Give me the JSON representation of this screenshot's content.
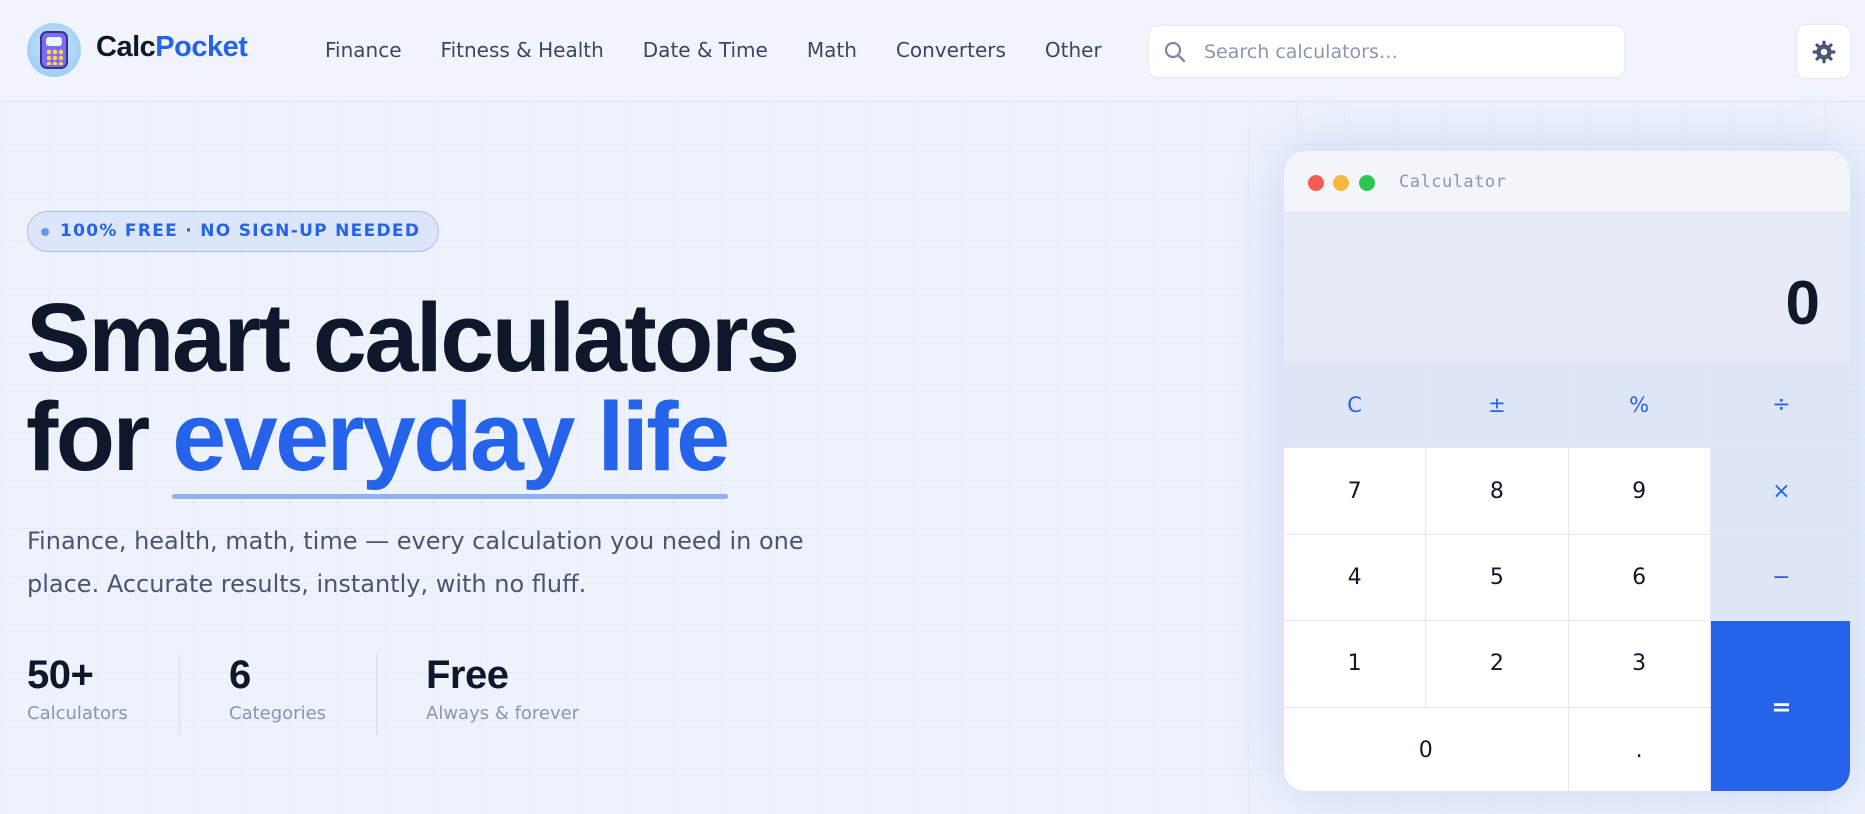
{
  "header": {
    "brand_part1": "Calc",
    "brand_part2": "Pocket",
    "nav": [
      "Finance",
      "Fitness & Health",
      "Date & Time",
      "Math",
      "Converters",
      "Other"
    ],
    "search_placeholder": "Search calculators…",
    "search_icon": "search-icon",
    "settings_icon": "gear-icon"
  },
  "hero": {
    "badge": "100% FREE · NO SIGN-UP NEEDED",
    "headline_line1": "Smart calculators",
    "headline_for": "for ",
    "headline_accent": "everyday life",
    "subtitle": "Finance, health, math, time — every calculation you need in one place. Accurate results, instantly, with no fluff.",
    "stats": [
      {
        "value": "50+",
        "label": "Calculators"
      },
      {
        "value": "6",
        "label": "Categories"
      },
      {
        "value": "Free",
        "label": "Always & forever"
      }
    ]
  },
  "calculator": {
    "title": "Calculator",
    "display": "0",
    "keys": {
      "clear": "C",
      "sign": "±",
      "percent": "%",
      "divide": "÷",
      "seven": "7",
      "eight": "8",
      "nine": "9",
      "multiply": "×",
      "four": "4",
      "five": "5",
      "six": "6",
      "minus": "−",
      "one": "1",
      "two": "2",
      "three": "3",
      "equals": "=",
      "zero": "0",
      "decimal": "."
    }
  },
  "colors": {
    "accent": "#2563eb",
    "text_dark": "#0f172a",
    "background": "#eef2fb"
  }
}
